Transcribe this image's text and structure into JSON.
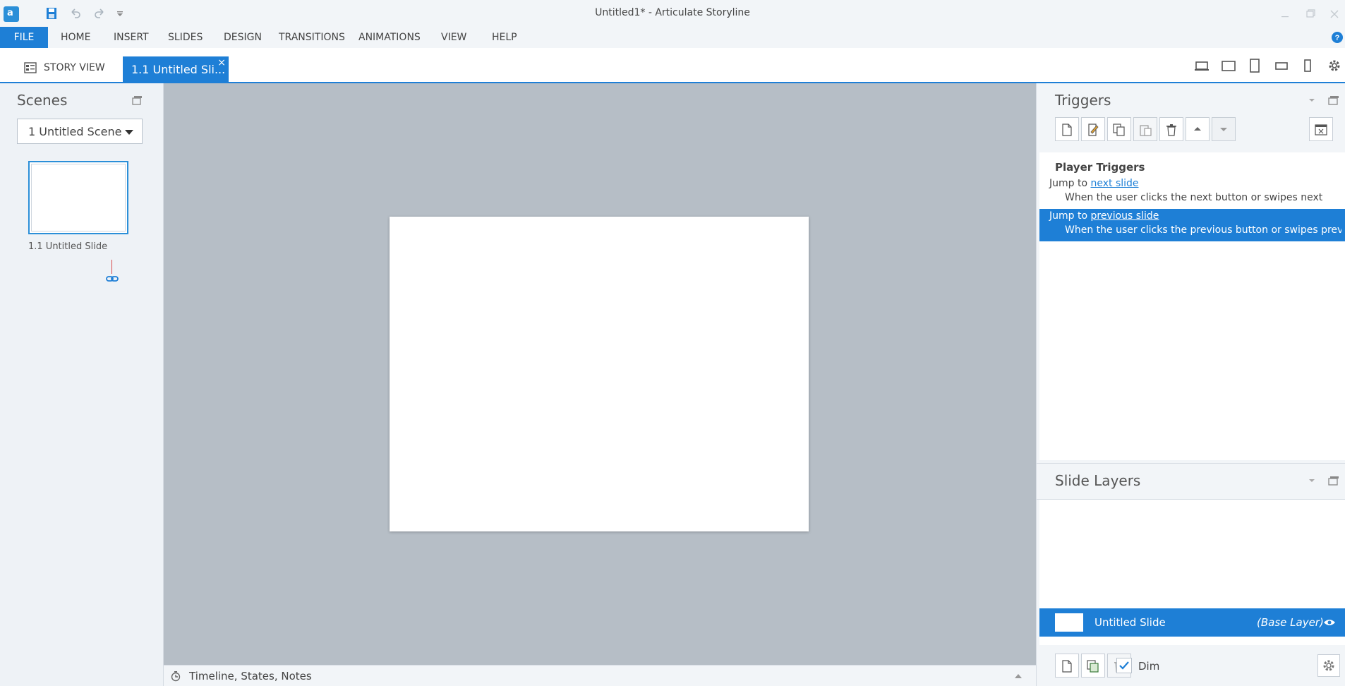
{
  "window": {
    "title": "Untitled1* -  Articulate Storyline",
    "app_icon": "storyline-logo-icon",
    "logo_letter": "a"
  },
  "quick_access": [
    "save-icon",
    "undo-icon",
    "redo-icon",
    "customize-dropdown-icon"
  ],
  "window_controls": [
    "minimize-icon",
    "restore-icon",
    "close-icon"
  ],
  "menu": {
    "items": [
      "FILE",
      "HOME",
      "INSERT",
      "SLIDES",
      "DESIGN",
      "TRANSITIONS",
      "ANIMATIONS",
      "VIEW",
      "HELP"
    ],
    "help_icon": "help-icon"
  },
  "tabs": {
    "story_view": "STORY VIEW",
    "slide_tab": "1.1 Untitled Sli...",
    "slide_tab_close": "×"
  },
  "device_preview_icons": [
    "desktop-icon",
    "tablet-landscape-icon",
    "tablet-portrait-icon",
    "phone-landscape-icon",
    "phone-portrait-icon",
    "gear-icon"
  ],
  "scenes": {
    "title": "Scenes",
    "selected_scene": "1 Untitled Scene",
    "slides": [
      {
        "label": "1.1 Untitled Slide"
      }
    ]
  },
  "bottom_bar": {
    "label": "Timeline, States, Notes"
  },
  "triggers": {
    "title": "Triggers",
    "toolbar": [
      "new-trigger-icon",
      "edit-trigger-icon",
      "copy-icon",
      "paste-icon",
      "delete-icon",
      "move-up-icon",
      "move-down-icon",
      "variables-icon"
    ],
    "heading": "Player Triggers",
    "items": [
      {
        "action_prefix": "Jump to",
        "action_link": "next slide",
        "condition": "When the user clicks the next button or swipes next",
        "selected": false
      },
      {
        "action_prefix": "Jump to",
        "action_link": "previous slide",
        "condition": "When the user clicks the previous button or swipes prev...",
        "selected": true
      }
    ]
  },
  "slide_layers": {
    "title": "Slide Layers",
    "base_layer": {
      "name": "Untitled Slide",
      "tag": "(Base Layer)"
    },
    "toolbar": [
      "new-layer-icon",
      "duplicate-layer-icon",
      "delete-layer-icon"
    ],
    "dim_label": "Dim",
    "dim_checked": true
  },
  "colors": {
    "accent": "#1e7fd6",
    "canvas_bg": "#b6bec6",
    "panel_bg": "#f2f5f8"
  }
}
